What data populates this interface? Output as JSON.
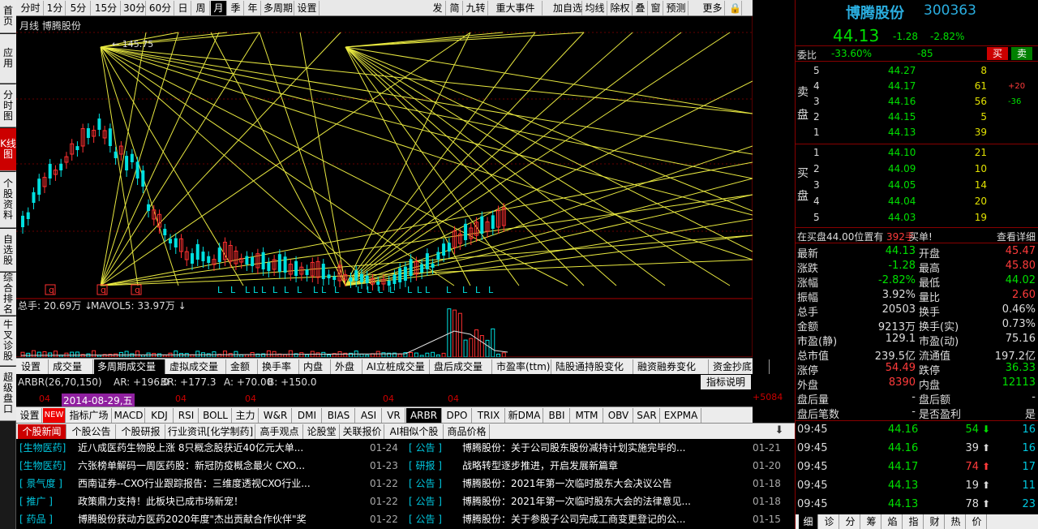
{
  "left_tabs": [
    {
      "label": "首页",
      "active": false
    },
    {
      "label": "应用",
      "active": false
    },
    {
      "label": "分时图",
      "active": false
    },
    {
      "label": "K线图",
      "active": true
    },
    {
      "label": "个股资料",
      "active": false
    },
    {
      "label": "自选股",
      "active": false
    },
    {
      "label": "综合排名",
      "active": false
    },
    {
      "label": "牛叉诊股",
      "active": false
    },
    {
      "label": "超级盘口",
      "active": false
    }
  ],
  "toolbar": {
    "periods": [
      "分时",
      "1分",
      "5分",
      "15分",
      "30分",
      "60分",
      "日",
      "周",
      "月",
      "季",
      "年",
      "多周期",
      "设置"
    ],
    "active_period": "月",
    "right_items": [
      "发",
      "简",
      "九转",
      "重大事件",
      "加自选",
      "均线",
      "除权",
      "叠",
      "窗",
      "预测",
      "更多"
    ]
  },
  "chart": {
    "title": "月线  博腾股份",
    "high_label": "145.75",
    "y_labels": [
      "153.46",
      "115.28",
      "76.63",
      "37.98"
    ],
    "current_price_label": "76.63",
    "q_markers": [
      "q",
      "q",
      "q"
    ],
    "volume_info": {
      "label": "总手: 20.69万",
      "ma": "MAVOL5: 33.97万"
    },
    "vol_labels": [
      "85470",
      "42735",
      "X100"
    ]
  },
  "indicator_tabs": [
    "设置",
    "成交量",
    "多周期成交量",
    "虚拟成交量",
    "金额",
    "换手率",
    "内盘",
    "外盘",
    "AI立桩成交量",
    "盘后成交量",
    "市盈率(ttm)",
    "陆股通持股变化",
    "融资融券变化",
    "资金抄底"
  ],
  "indicator_active": "多周期成交量",
  "indicator_help": "指标说明",
  "arbr": {
    "name": "ARBR(26,70,150)",
    "ar": "AR: +196.0",
    "br": "BR: +177.3",
    "a": "A: +70.00",
    "b": "B: +150.0",
    "right_label": "+5084"
  },
  "date_axis": {
    "labels": [
      "04",
      "04",
      "04",
      "04",
      "04"
    ],
    "selected": "2014-08-29,五"
  },
  "indicator_row2": [
    "设置",
    "NEW",
    "指标广场",
    "MACD",
    "KDJ",
    "RSI",
    "BOLL",
    "主力",
    "W&R",
    "DMI",
    "BIAS",
    "ASI",
    "VR",
    "ARBR",
    "DPO",
    "TRIX",
    "新DMA",
    "BBI",
    "MTM",
    "OBV",
    "SAR",
    "EXPMA"
  ],
  "indicator_row2_active": "ARBR",
  "news_tabs": [
    "个股新闻",
    "个股公告",
    "个股研报",
    "行业资讯[化学制药]",
    "高手观点",
    "论股堂",
    "关联报价",
    "AI相似个股",
    "商品价格"
  ],
  "news_left": [
    {
      "tag": "[生物医药]",
      "title": "近八成医药生物股上涨 8只概念股获近40亿元大单...",
      "date": "01-24"
    },
    {
      "tag": "[生物医药]",
      "title": "六张榜单解码一周医药股：新冠防疫概念最火 CXO...",
      "date": "01-23"
    },
    {
      "tag": "[ 景气度 ]",
      "title": "西南证券--CXO行业跟踪报告：三维度透视CXO行业...",
      "date": "01-22"
    },
    {
      "tag": "[  推广  ]",
      "title": "政策鼎力支持！此板块已成市场新宠！",
      "date": "01-22"
    },
    {
      "tag": "[  药品  ]",
      "title": "博腾股份获动方医药2020年度\"杰出贡献合作伙伴\"奖",
      "date": "01-22"
    }
  ],
  "news_right": [
    {
      "tag": "[ 公告 ]",
      "title": "博腾股份：关于公司股东股份减持计划实施完毕的...",
      "date": "01-21"
    },
    {
      "tag": "[ 研报 ]",
      "title": "战略转型逐步推进，开启发展新篇章",
      "date": "01-20"
    },
    {
      "tag": "[ 公告 ]",
      "title": "博腾股份：2021年第一次临时股东大会决议公告",
      "date": "01-18"
    },
    {
      "tag": "[ 公告 ]",
      "title": "博腾股份：2021年第一次临时股东大会的法律意见...",
      "date": "01-18"
    },
    {
      "tag": "[ 公告 ]",
      "title": "博腾股份：关于参股子公司完成工商变更登记的公...",
      "date": "01-15"
    }
  ],
  "quote": {
    "name": "博腾股份",
    "code": "300363",
    "price": "44.13",
    "change": "-1.28",
    "pct": "-2.82%",
    "weibi_label": "委比",
    "weibi": "-33.60%",
    "weicha": "-85",
    "buy_btn": "买",
    "sell_btn": "卖",
    "sell_label": "卖盘",
    "buy_label": "买盘",
    "asks": [
      {
        "lv": "5",
        "price": "44.27",
        "vol": "8",
        "chg": ""
      },
      {
        "lv": "4",
        "price": "44.17",
        "vol": "61",
        "chg": "+20"
      },
      {
        "lv": "3",
        "price": "44.16",
        "vol": "56",
        "chg": "-36"
      },
      {
        "lv": "2",
        "price": "44.15",
        "vol": "5",
        "chg": ""
      },
      {
        "lv": "1",
        "price": "44.13",
        "vol": "39",
        "chg": ""
      }
    ],
    "bids": [
      {
        "lv": "1",
        "price": "44.10",
        "vol": "21"
      },
      {
        "lv": "2",
        "price": "44.09",
        "vol": "10"
      },
      {
        "lv": "3",
        "price": "44.05",
        "vol": "14"
      },
      {
        "lv": "4",
        "price": "44.04",
        "vol": "20"
      },
      {
        "lv": "5",
        "price": "44.03",
        "vol": "19"
      }
    ],
    "alert_pre": "在买盘44.00位置有",
    "alert_vol": "392手",
    "alert_post": " 买单!",
    "alert_link": "查看详细",
    "stats": [
      [
        "最新",
        "44.13",
        "g",
        "开盘",
        "45.47",
        "r"
      ],
      [
        "涨跌",
        "-1.28",
        "g",
        "最高",
        "45.80",
        "r"
      ],
      [
        "涨幅",
        "-2.82%",
        "g",
        "最低",
        "44.02",
        "g"
      ],
      [
        "振幅",
        "3.92%",
        "w",
        "量比",
        "2.60",
        "r"
      ],
      [
        "总手",
        "20503",
        "w",
        "换手",
        "0.46%",
        "w"
      ],
      [
        "金额",
        "9213万",
        "w",
        "换手(实)",
        "0.73%",
        "w"
      ],
      [
        "市盈(静)",
        "129.1",
        "w",
        "市盈(动)",
        "75.16",
        "w"
      ],
      [
        "总市值",
        "239.5亿",
        "w",
        "流通值",
        "197.2亿",
        "w"
      ],
      [
        "涨停",
        "54.49",
        "r",
        "跌停",
        "36.33",
        "g"
      ],
      [
        "外盘",
        "8390",
        "r",
        "内盘",
        "12113",
        "g"
      ],
      [
        "盘后量",
        "-",
        "w",
        "盘后额",
        "-",
        "w"
      ],
      [
        "盘后笔数",
        "-",
        "w",
        "是否盈利",
        "是",
        "w"
      ]
    ],
    "ticks": [
      {
        "t": "09:45",
        "p": "44.16",
        "v": "54",
        "dir": "down",
        "n": "16"
      },
      {
        "t": "09:45",
        "p": "44.16",
        "v": "39",
        "dir": "up",
        "n": "16"
      },
      {
        "t": "09:45",
        "p": "44.17",
        "v": "74",
        "dir": "up-red",
        "n": "17"
      },
      {
        "t": "09:45",
        "p": "44.13",
        "v": "19",
        "dir": "up",
        "n": "11"
      },
      {
        "t": "09:45",
        "p": "44.13",
        "v": "78",
        "dir": "up",
        "n": "23"
      }
    ],
    "bottom_tabs": [
      "细",
      "诊",
      "分",
      "筹",
      "焰",
      "指",
      "财",
      "热",
      "价"
    ]
  }
}
